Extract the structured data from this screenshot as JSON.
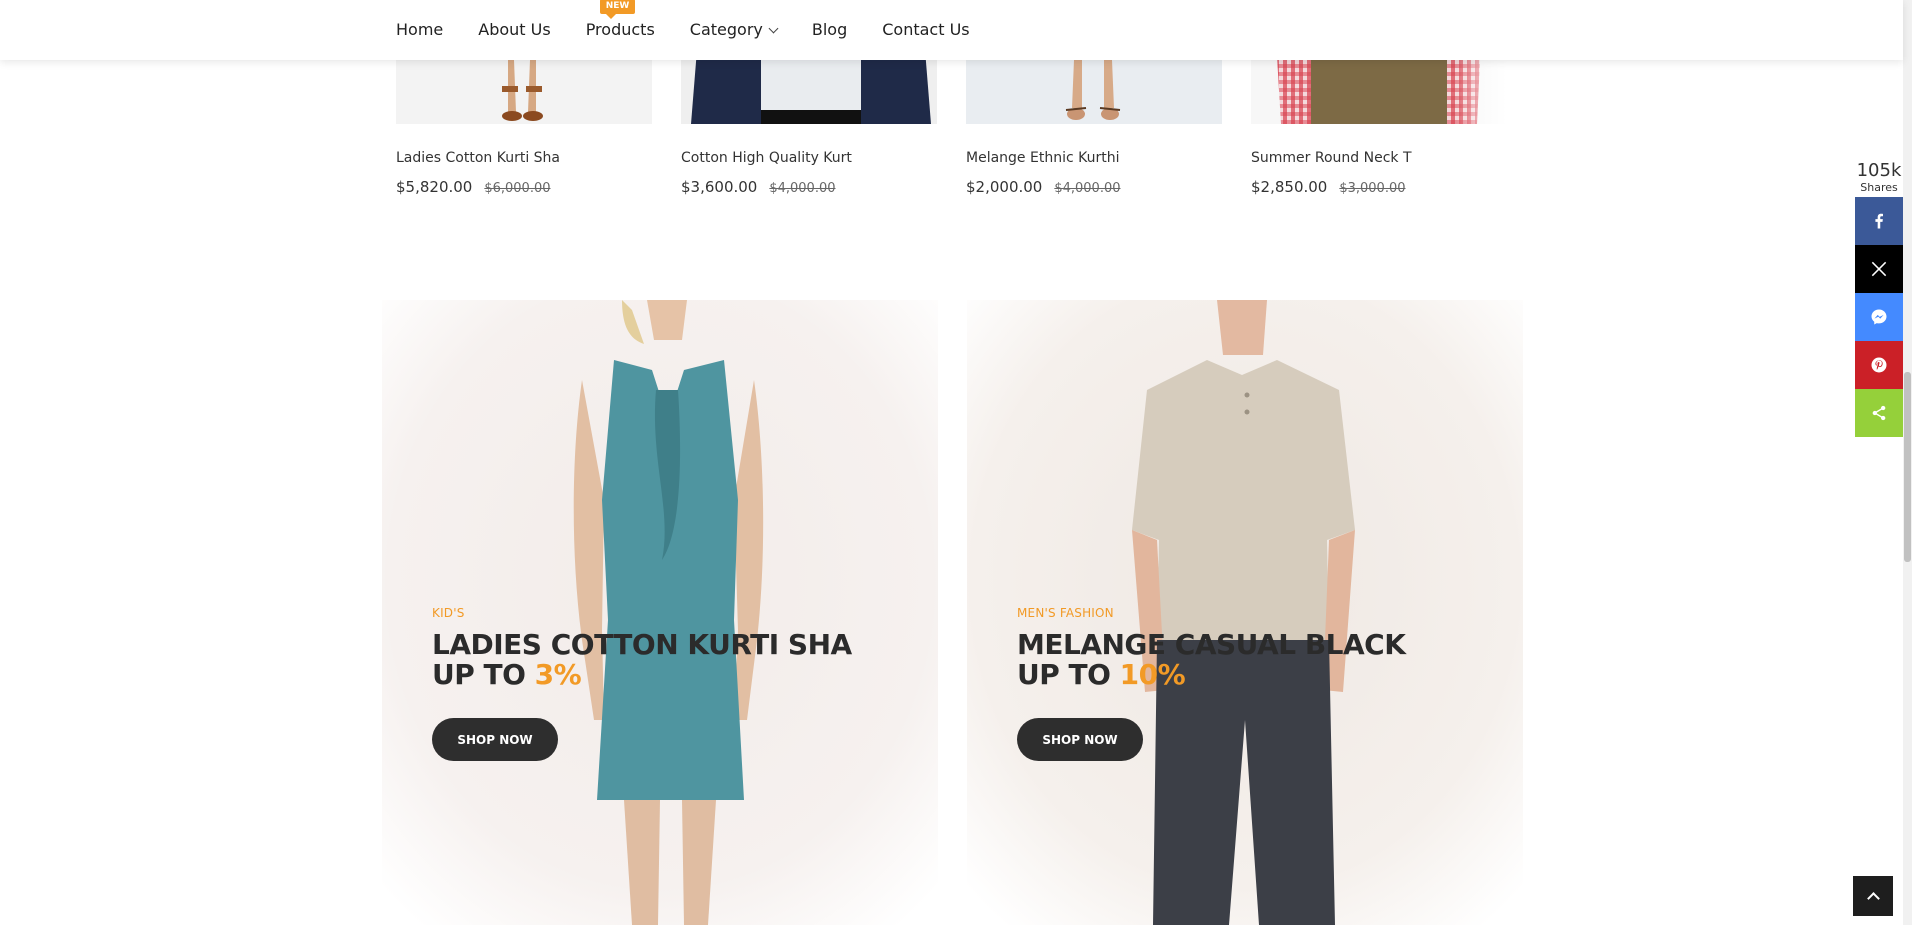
{
  "nav": {
    "items": [
      {
        "label": "Home"
      },
      {
        "label": "About Us"
      },
      {
        "label": "Products",
        "badge": "NEW"
      },
      {
        "label": "Category"
      },
      {
        "label": "Blog"
      },
      {
        "label": "Contact Us"
      }
    ]
  },
  "products": [
    {
      "name": "Ladies Cotton Kurti Sha",
      "price": "$5,820.00",
      "old_price": "$6,000.00"
    },
    {
      "name": "Cotton High Quality Kurt",
      "price": "$3,600.00",
      "old_price": "$4,000.00"
    },
    {
      "name": "Melange Ethnic Kurthi",
      "price": "$2,000.00",
      "old_price": "$4,000.00"
    },
    {
      "name": "Summer Round Neck T",
      "price": "$2,850.00",
      "old_price": "$3,000.00"
    }
  ],
  "banners": [
    {
      "category": "KID'S",
      "title_line1": "LADIES COTTON KURTI SHA",
      "title_prefix": "UP TO ",
      "percent": "3%",
      "button": "SHOP NOW"
    },
    {
      "category": "MEN'S FASHION",
      "title_line1": "MELANGE CASUAL BLACK",
      "title_prefix": "UP TO ",
      "percent": "10%",
      "button": "SHOP NOW"
    }
  ],
  "share": {
    "count": "105k",
    "label": "Shares",
    "buttons": [
      {
        "icon": "facebook-icon",
        "color": "#3b5998"
      },
      {
        "icon": "x-icon",
        "color": "#000000"
      },
      {
        "icon": "messenger-icon",
        "color": "#448aff"
      },
      {
        "icon": "pinterest-icon",
        "color": "#cb2027"
      },
      {
        "icon": "share-icon",
        "color": "#95d03a"
      }
    ]
  },
  "colors": {
    "accent": "#f29a26",
    "dark": "#2e2e2e"
  }
}
